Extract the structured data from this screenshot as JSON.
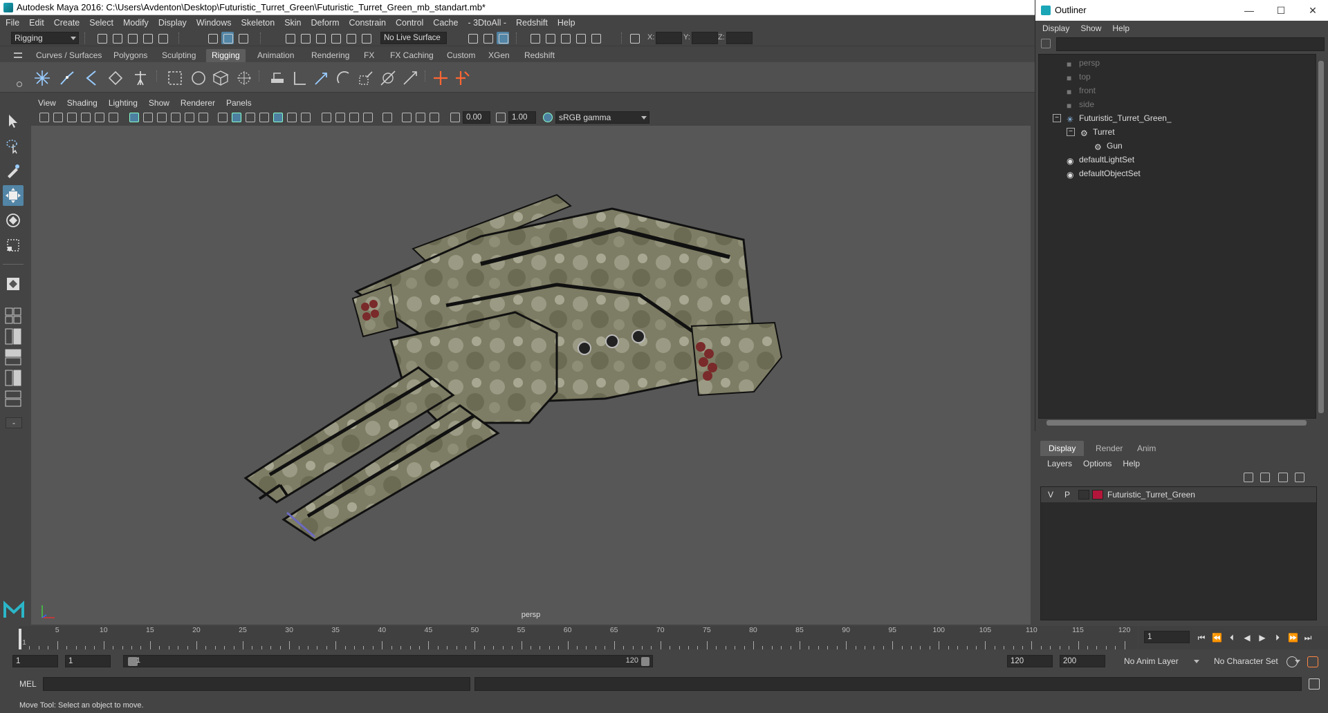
{
  "window": {
    "title": "Autodesk Maya 2016: C:\\Users\\Avdenton\\Desktop\\Futuristic_Turret_Green\\Futuristic_Turret_Green_mb_standart.mb*"
  },
  "menu_bar": [
    "File",
    "Edit",
    "Create",
    "Select",
    "Modify",
    "Display",
    "Windows",
    "Skeleton",
    "Skin",
    "Deform",
    "Constrain",
    "Control",
    "Cache",
    "- 3DtoAll -",
    "Redshift",
    "Help"
  ],
  "status_line": {
    "mode": "Rigging",
    "live_surface": "No Live Surface",
    "x_label": "X:",
    "y_label": "Y:",
    "z_label": "Z:"
  },
  "shelf_tabs": [
    "Curves / Surfaces",
    "Polygons",
    "Sculpting",
    "Rigging",
    "Animation",
    "Rendering",
    "FX",
    "FX Caching",
    "Custom",
    "XGen",
    "Redshift"
  ],
  "active_shelf_tab": "Rigging",
  "panel_menu": [
    "View",
    "Shading",
    "Lighting",
    "Show",
    "Renderer",
    "Panels"
  ],
  "panel_toolbar": {
    "exposure": "0.00",
    "gamma": "1.00",
    "color_space": "sRGB gamma"
  },
  "viewport": {
    "camera_label": "persp"
  },
  "time_slider": {
    "ticks": [
      1,
      5,
      10,
      15,
      20,
      25,
      30,
      35,
      40,
      45,
      50,
      55,
      60,
      65,
      70,
      75,
      80,
      85,
      90,
      95,
      100,
      105,
      110,
      115,
      120
    ],
    "current_frame": "1"
  },
  "range_slider": {
    "start_frame": "1",
    "start_range": "1",
    "range_bar_start": "1",
    "range_bar_end": "120",
    "end_range": "120",
    "end_frame": "200",
    "anim_layer": "No Anim Layer",
    "character_set": "No Character Set"
  },
  "command_line": {
    "label": "MEL"
  },
  "help_line": "Move Tool: Select an object to move.",
  "outliner": {
    "title": "Outliner",
    "menu": [
      "Display",
      "Show",
      "Help"
    ],
    "items": [
      {
        "label": "persp",
        "type": "camera",
        "dim": true
      },
      {
        "label": "top",
        "type": "camera",
        "dim": true
      },
      {
        "label": "front",
        "type": "camera",
        "dim": true
      },
      {
        "label": "side",
        "type": "camera",
        "dim": true
      },
      {
        "label": "Futuristic_Turret_Green_",
        "type": "joint"
      },
      {
        "label": "Turret",
        "type": "transform"
      },
      {
        "label": "Gun",
        "type": "transform"
      },
      {
        "label": "defaultLightSet",
        "type": "set"
      },
      {
        "label": "defaultObjectSet",
        "type": "set"
      }
    ]
  },
  "layer_editor": {
    "tabs": [
      "Display",
      "Render",
      "Anim"
    ],
    "active_tab": "Display",
    "menu": [
      "Layers",
      "Options",
      "Help"
    ],
    "layer": {
      "visibility": "V",
      "playback": "P",
      "name": "Futuristic_Turret_Green",
      "color": "#b3163a"
    }
  },
  "colors": {
    "accent": "#5285a6",
    "panel": "#444444",
    "viewport": "#575757",
    "field": "#2b2b2b"
  }
}
